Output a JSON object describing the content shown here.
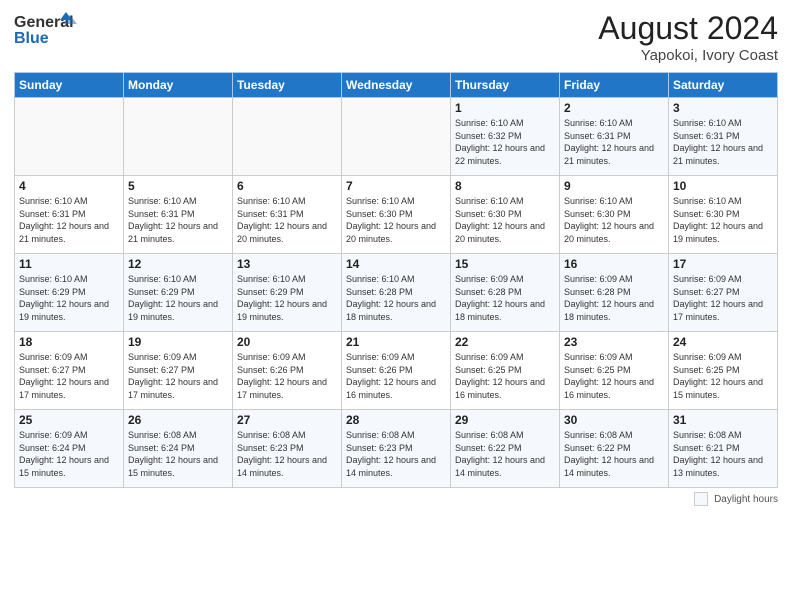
{
  "logo": {
    "line1": "General",
    "line2": "Blue"
  },
  "title": "August 2024",
  "location": "Yapokoi, Ivory Coast",
  "days_of_week": [
    "Sunday",
    "Monday",
    "Tuesday",
    "Wednesday",
    "Thursday",
    "Friday",
    "Saturday"
  ],
  "footer_label": "Daylight hours",
  "weeks": [
    [
      {
        "day": "",
        "info": ""
      },
      {
        "day": "",
        "info": ""
      },
      {
        "day": "",
        "info": ""
      },
      {
        "day": "",
        "info": ""
      },
      {
        "day": "1",
        "info": "Sunrise: 6:10 AM\nSunset: 6:32 PM\nDaylight: 12 hours and 22 minutes."
      },
      {
        "day": "2",
        "info": "Sunrise: 6:10 AM\nSunset: 6:31 PM\nDaylight: 12 hours and 21 minutes."
      },
      {
        "day": "3",
        "info": "Sunrise: 6:10 AM\nSunset: 6:31 PM\nDaylight: 12 hours and 21 minutes."
      }
    ],
    [
      {
        "day": "4",
        "info": "Sunrise: 6:10 AM\nSunset: 6:31 PM\nDaylight: 12 hours and 21 minutes."
      },
      {
        "day": "5",
        "info": "Sunrise: 6:10 AM\nSunset: 6:31 PM\nDaylight: 12 hours and 21 minutes."
      },
      {
        "day": "6",
        "info": "Sunrise: 6:10 AM\nSunset: 6:31 PM\nDaylight: 12 hours and 20 minutes."
      },
      {
        "day": "7",
        "info": "Sunrise: 6:10 AM\nSunset: 6:30 PM\nDaylight: 12 hours and 20 minutes."
      },
      {
        "day": "8",
        "info": "Sunrise: 6:10 AM\nSunset: 6:30 PM\nDaylight: 12 hours and 20 minutes."
      },
      {
        "day": "9",
        "info": "Sunrise: 6:10 AM\nSunset: 6:30 PM\nDaylight: 12 hours and 20 minutes."
      },
      {
        "day": "10",
        "info": "Sunrise: 6:10 AM\nSunset: 6:30 PM\nDaylight: 12 hours and 19 minutes."
      }
    ],
    [
      {
        "day": "11",
        "info": "Sunrise: 6:10 AM\nSunset: 6:29 PM\nDaylight: 12 hours and 19 minutes."
      },
      {
        "day": "12",
        "info": "Sunrise: 6:10 AM\nSunset: 6:29 PM\nDaylight: 12 hours and 19 minutes."
      },
      {
        "day": "13",
        "info": "Sunrise: 6:10 AM\nSunset: 6:29 PM\nDaylight: 12 hours and 19 minutes."
      },
      {
        "day": "14",
        "info": "Sunrise: 6:10 AM\nSunset: 6:28 PM\nDaylight: 12 hours and 18 minutes."
      },
      {
        "day": "15",
        "info": "Sunrise: 6:09 AM\nSunset: 6:28 PM\nDaylight: 12 hours and 18 minutes."
      },
      {
        "day": "16",
        "info": "Sunrise: 6:09 AM\nSunset: 6:28 PM\nDaylight: 12 hours and 18 minutes."
      },
      {
        "day": "17",
        "info": "Sunrise: 6:09 AM\nSunset: 6:27 PM\nDaylight: 12 hours and 17 minutes."
      }
    ],
    [
      {
        "day": "18",
        "info": "Sunrise: 6:09 AM\nSunset: 6:27 PM\nDaylight: 12 hours and 17 minutes."
      },
      {
        "day": "19",
        "info": "Sunrise: 6:09 AM\nSunset: 6:27 PM\nDaylight: 12 hours and 17 minutes."
      },
      {
        "day": "20",
        "info": "Sunrise: 6:09 AM\nSunset: 6:26 PM\nDaylight: 12 hours and 17 minutes."
      },
      {
        "day": "21",
        "info": "Sunrise: 6:09 AM\nSunset: 6:26 PM\nDaylight: 12 hours and 16 minutes."
      },
      {
        "day": "22",
        "info": "Sunrise: 6:09 AM\nSunset: 6:25 PM\nDaylight: 12 hours and 16 minutes."
      },
      {
        "day": "23",
        "info": "Sunrise: 6:09 AM\nSunset: 6:25 PM\nDaylight: 12 hours and 16 minutes."
      },
      {
        "day": "24",
        "info": "Sunrise: 6:09 AM\nSunset: 6:25 PM\nDaylight: 12 hours and 15 minutes."
      }
    ],
    [
      {
        "day": "25",
        "info": "Sunrise: 6:09 AM\nSunset: 6:24 PM\nDaylight: 12 hours and 15 minutes."
      },
      {
        "day": "26",
        "info": "Sunrise: 6:08 AM\nSunset: 6:24 PM\nDaylight: 12 hours and 15 minutes."
      },
      {
        "day": "27",
        "info": "Sunrise: 6:08 AM\nSunset: 6:23 PM\nDaylight: 12 hours and 14 minutes."
      },
      {
        "day": "28",
        "info": "Sunrise: 6:08 AM\nSunset: 6:23 PM\nDaylight: 12 hours and 14 minutes."
      },
      {
        "day": "29",
        "info": "Sunrise: 6:08 AM\nSunset: 6:22 PM\nDaylight: 12 hours and 14 minutes."
      },
      {
        "day": "30",
        "info": "Sunrise: 6:08 AM\nSunset: 6:22 PM\nDaylight: 12 hours and 14 minutes."
      },
      {
        "day": "31",
        "info": "Sunrise: 6:08 AM\nSunset: 6:21 PM\nDaylight: 12 hours and 13 minutes."
      }
    ]
  ]
}
